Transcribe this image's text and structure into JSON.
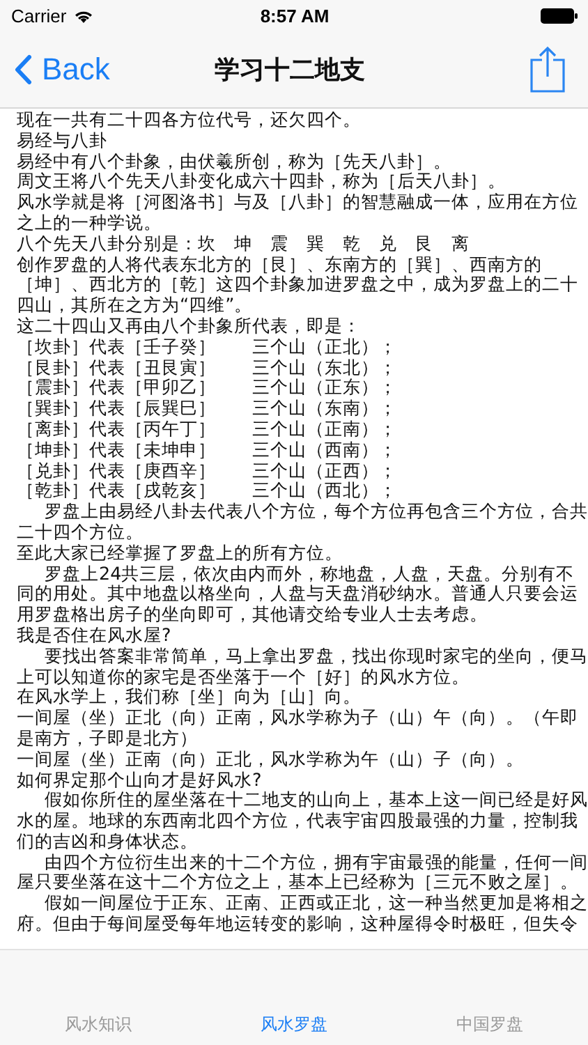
{
  "status_bar": {
    "carrier": "Carrier",
    "time": "8:57 AM"
  },
  "nav": {
    "back": "Back",
    "title": "学习十二地支"
  },
  "paragraphs": [
    {
      "text": "现在一共有二十四各方位代号，还欠四个。",
      "indent": false
    },
    {
      "text": "易经与八卦",
      "indent": false
    },
    {
      "text": "易经中有八个卦象，由伏羲所创，称为［先天八卦］。",
      "indent": false
    },
    {
      "text": "周文王将八个先天八卦变化成六十四卦，称为［后天八卦］。",
      "indent": false
    },
    {
      "text": "风水学就是将［河图洛书］与及［八卦］的智慧融成一体，应用在方位之上的一种学说。",
      "indent": false
    },
    {
      "text": "八个先天八卦分别是：坎　坤　震　巽　乾　兑　艮　离",
      "indent": false
    },
    {
      "text": "创作罗盘的人将代表东北方的［艮］、东南方的［巽］、西南方的［坤］、西北方的［乾］这四个卦象加进罗盘之中，成为罗盘上的二十四山，其所在之方为“四维”。",
      "indent": false
    },
    {
      "text": "这二十四山又再由八个卦象所代表，即是：",
      "indent": false
    },
    {
      "text": "［坎卦］代表［壬子癸］　　三个山（正北）；",
      "indent": false
    },
    {
      "text": "［艮卦］代表［丑艮寅］　　三个山（东北）；",
      "indent": false
    },
    {
      "text": "［震卦］代表［甲卯乙］　　三个山（正东）；",
      "indent": false
    },
    {
      "text": "［巽卦］代表［辰巽巳］　　三个山（东南）；",
      "indent": false
    },
    {
      "text": "［离卦］代表［丙午丁］　　三个山（正南）；",
      "indent": false
    },
    {
      "text": "［坤卦］代表［未坤申］　　三个山（西南）；",
      "indent": false
    },
    {
      "text": "［兑卦］代表［庚酉辛］　　三个山（正西）；",
      "indent": false
    },
    {
      "text": "［乾卦］代表［戌乾亥］　　三个山（西北）；",
      "indent": false
    },
    {
      "text": "罗盘上由易经八卦去代表八个方位，每个方位再包含三个方位，合共二十四个方位。",
      "indent": true
    },
    {
      "text": "至此大家已经掌握了罗盘上的所有方位。",
      "indent": false
    },
    {
      "text": "罗盘上24共三层，依次由内而外，称地盘，人盘，天盘。分别有不同的用处。其中地盘以格坐向，人盘与天盘消砂纳水。普通人只要会运用罗盘格出房子的坐向即可，其他请交给专业人士去考虑。",
      "indent": true
    },
    {
      "text": "我是否住在风水屋?",
      "indent": false
    },
    {
      "text": "要找出答案非常简单，马上拿出罗盘，找出你现时家宅的坐向，便马上可以知道你的家宅是否坐落于一个［好］的风水方位。",
      "indent": true
    },
    {
      "text": "在风水学上，我们称［坐］向为［山］向。",
      "indent": false
    },
    {
      "text": "一间屋（坐）正北（向）正南，风水学称为子（山）午（向）。（午即是南方，子即是北方）",
      "indent": false
    },
    {
      "text": "一间屋（坐）正南（向）正北，风水学称为午（山）子（向）。",
      "indent": false
    },
    {
      "text": "如何界定那个山向才是好风水?",
      "indent": false
    },
    {
      "text": "假如你所住的屋坐落在十二地支的山向上，基本上这一间已经是好风水的屋。地球的东西南北四个方位，代表宇宙四股最强的力量，控制我们的吉凶和身体状态。",
      "indent": true
    },
    {
      "text": "由四个方位衍生出来的十二个方位，拥有宇宙最强的能量，任何一间屋只要坐落在这十二个方位之上，基本上已经称为［三元不败之屋］。",
      "indent": true
    },
    {
      "text": "假如一间屋位于正东、正南、正西或正北，这一种当然更加是将相之府。但由于每间屋受每年地运转变的影响，这种屋得令时极旺，但失令",
      "indent": true
    }
  ],
  "tabs": [
    {
      "label": "风水知识",
      "selected": false
    },
    {
      "label": "风水罗盘",
      "selected": true
    },
    {
      "label": "中国罗盘",
      "selected": false
    }
  ]
}
